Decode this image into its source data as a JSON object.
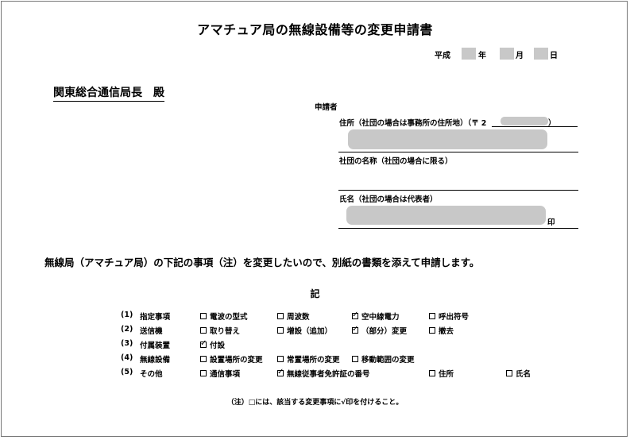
{
  "title": "アマチュア局の無線設備等の変更申請書",
  "date": {
    "era": "平成",
    "year_unit": "年",
    "month_unit": "月",
    "day_unit": "日"
  },
  "addressee": "関東総合通信局長　殿",
  "applicant": {
    "heading": "申請者",
    "address_label": "住所（社団の場合は事務所の住所地）（〒",
    "postal_visible": "2",
    "postal_close": "）",
    "club_name_label": "社団の名称（社団の場合に限る）",
    "name_label": "氏名（社団の場合は代表者）",
    "seal": "印"
  },
  "declaration": "無線局（アマチュア局）の下記の事項（注）を変更したいので、別紙の書類を添えて申請します。",
  "ki": "記",
  "items": [
    {
      "num": "(1)",
      "label": "指定事項",
      "options": [
        {
          "text": "電波の型式",
          "checked": false
        },
        {
          "text": "周波数",
          "checked": false
        },
        {
          "text": "空中線電力",
          "checked": true
        },
        {
          "text": "呼出符号",
          "checked": false
        }
      ]
    },
    {
      "num": "(2)",
      "label": "送信機",
      "options": [
        {
          "text": "取り替え",
          "checked": false
        },
        {
          "text": "増設（追加）",
          "checked": false
        },
        {
          "text": "（部分）変更",
          "checked": true
        },
        {
          "text": "撤去",
          "checked": false
        }
      ]
    },
    {
      "num": "(3)",
      "label": "付属装置",
      "options": [
        {
          "text": "付設",
          "checked": true
        }
      ]
    },
    {
      "num": "(4)",
      "label": "無線設備",
      "options": [
        {
          "text": "設置場所の変更",
          "checked": false
        },
        {
          "text": "常置場所の変更",
          "checked": false
        },
        {
          "text": "移動範囲の変更",
          "checked": false
        }
      ]
    },
    {
      "num": "(5)",
      "label": "その他",
      "options": [
        {
          "text": "通信事項",
          "checked": false
        },
        {
          "text": "無線従事者免許証の番号",
          "checked": true
        },
        {
          "text": "住所",
          "checked": false
        },
        {
          "text": "氏名",
          "checked": false
        }
      ]
    }
  ],
  "note": "（注）□には、該当する変更事項に√印を付けること。"
}
